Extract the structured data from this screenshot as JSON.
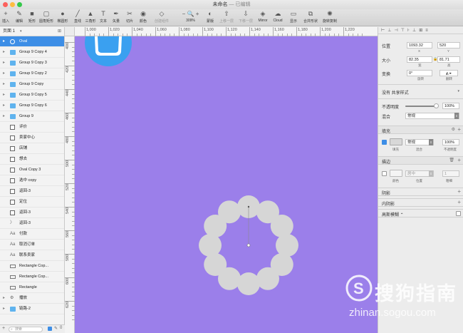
{
  "window": {
    "title": "未命名",
    "subtitle": "— 已编辑"
  },
  "toolbar": {
    "items": [
      {
        "label": "插入",
        "icon": "+"
      },
      {
        "label": "编辑",
        "icon": "✎"
      },
      {
        "label": "矩形",
        "icon": "■"
      },
      {
        "label": "圆角矩形",
        "icon": "▢"
      },
      {
        "label": "椭圆形",
        "icon": "●"
      },
      {
        "label": "直线",
        "icon": "╱"
      },
      {
        "label": "三角形",
        "icon": "▲"
      },
      {
        "label": "文本",
        "icon": "T"
      },
      {
        "label": "矢量",
        "icon": "✒"
      },
      {
        "label": "切片",
        "icon": "✂"
      },
      {
        "label": "颜色",
        "icon": "◉"
      },
      {
        "label": "创建组件",
        "icon": "◇"
      }
    ],
    "zoom": {
      "label": "309%",
      "minus": "−",
      "plus": "+"
    },
    "right_items": [
      {
        "label": "蒙版",
        "icon": "◐"
      },
      {
        "label": "上移一层",
        "icon": "⇧"
      },
      {
        "label": "下移一层",
        "icon": "⇩"
      },
      {
        "label": "Mirror",
        "icon": "◈"
      },
      {
        "label": "Cloud",
        "icon": "☁"
      },
      {
        "label": "显示",
        "icon": "▭"
      },
      {
        "label": "合并形状",
        "icon": "⧉"
      },
      {
        "label": "旋转复制",
        "icon": "✺"
      }
    ]
  },
  "sidebar": {
    "page": "页面 1",
    "layers": [
      {
        "name": "Oval",
        "type": "oval",
        "arrow": "▸",
        "selected": true
      },
      {
        "name": "Group 9 Copy 4",
        "type": "folder",
        "arrow": "▸"
      },
      {
        "name": "Group 9 Copy 3",
        "type": "folder",
        "arrow": "▸"
      },
      {
        "name": "Group 9 Copy 2",
        "type": "folder",
        "arrow": "▸"
      },
      {
        "name": "Group 9 Copy",
        "type": "folder",
        "arrow": "▸"
      },
      {
        "name": "Group 9 Copy 5",
        "type": "folder",
        "arrow": "▸"
      },
      {
        "name": "Group 9 Copy 6",
        "type": "folder",
        "arrow": "▸"
      },
      {
        "name": "Group 9",
        "type": "folder",
        "arrow": "▸"
      },
      {
        "name": "评价",
        "type": "symbol"
      },
      {
        "name": "卖家中心",
        "type": "symbol"
      },
      {
        "name": "店铺",
        "type": "symbol"
      },
      {
        "name": "想去",
        "type": "symbol"
      },
      {
        "name": "Oval Copy 3",
        "type": "symbol"
      },
      {
        "name": "选中 copy",
        "type": "symbol"
      },
      {
        "name": "返回-3",
        "type": "symbol"
      },
      {
        "name": "定位",
        "type": "symbol"
      },
      {
        "name": "返回-3",
        "type": "symbol"
      },
      {
        "name": "返回-3",
        "type": "chevron"
      },
      {
        "name": "付款",
        "type": "text"
      },
      {
        "name": "取消订单",
        "type": "text"
      },
      {
        "name": "联系卖家",
        "type": "text"
      },
      {
        "name": "Rectangle Cop...",
        "type": "rect"
      },
      {
        "name": "Rectangle Cop...",
        "type": "rect"
      },
      {
        "name": "Rectangle",
        "type": "rect"
      },
      {
        "name": "播放",
        "type": "gear",
        "arrow": "▸"
      },
      {
        "name": "链路-2",
        "type": "folder",
        "arrow": "▸"
      }
    ],
    "search_placeholder": "搜索",
    "bottom_count": "0"
  },
  "rulers": {
    "top": [
      "1,000",
      "1,020",
      "1,040",
      "1,060",
      "1,080",
      "1,100",
      "1,120",
      "1,140",
      "1,160",
      "1,180",
      "1,200",
      "1,220"
    ],
    "left": [
      "400",
      "420",
      "440",
      "460",
      "480",
      "500",
      "520",
      "540",
      "560",
      "580",
      "600",
      "620"
    ]
  },
  "inspector": {
    "position_label": "位置",
    "x": "1093.32",
    "y": "520",
    "x_label": "X",
    "y_label": "Y",
    "size_label": "大小",
    "width": "82.35",
    "height": "81.71",
    "w_label": "宽",
    "h_label": "高",
    "transform_label": "变换",
    "rotation": "0°",
    "rotation_label": "旋转",
    "flip_label": "翻转",
    "shared_style": "没有 共享样式",
    "opacity_label": "不透明度",
    "opacity": "100%",
    "opacity_fraction": 1.0,
    "blend_label": "混合",
    "blend": "常规",
    "fill_header": "填充",
    "fill": {
      "blend": "常规",
      "opacity": "100%",
      "color_label": "填充",
      "blend_label": "混合",
      "opacity_label": "不透明度",
      "color": "#d8d8d8"
    },
    "border_header": "描边",
    "border": {
      "position": "居中",
      "thickness": "1",
      "color_label": "颜色",
      "position_label": "位置",
      "thickness_label": "粗细"
    },
    "shadow_header": "阴影",
    "inner_shadow_header": "内阴影",
    "blur_header": "高斯模糊 ⌃"
  },
  "canvas": {
    "background": "#9b7fea",
    "circle_color": "#d6d6d6"
  },
  "watermark": {
    "text": "搜狗指南",
    "url": "zhinan.sogou.com"
  }
}
